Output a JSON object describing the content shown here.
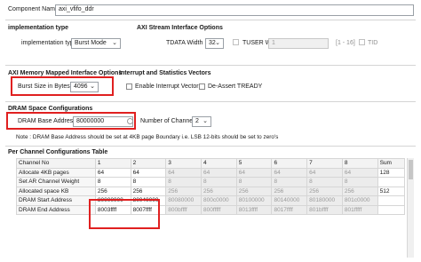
{
  "component": {
    "label": "Component Name",
    "value": "axi_vfifo_ddr"
  },
  "implementation": {
    "section": "implementation type",
    "label": "implementation type",
    "value": "Burst Mode"
  },
  "stream": {
    "section": "AXI Stream Interface Options",
    "tdata_label": "TDATA Width",
    "tdata_value": "32",
    "tuser_label": "TUSER Width",
    "tuser_value": "1",
    "range_hint": "[1 - 16]",
    "tid_label": "TID"
  },
  "mm": {
    "section": "AXI Memory Mapped Interface Options",
    "burst_label": "Burst Size in Bytes",
    "burst_value": "4096"
  },
  "interrupts": {
    "section": "Interrupt and Statistics Vectors",
    "enable_label": "Enable Interrupt Vectors",
    "deassert_label": "De-Assert TREADY"
  },
  "dram": {
    "section": "DRAM Space Configurations",
    "base_label": "DRAM Base Address",
    "base_value": "80000000",
    "channels_label": "Number of Channels",
    "channels_value": "2",
    "note": "Note : DRAM Base Address should be set at 4KB page Boundary i.e. LSB 12-bits should be set to zero's"
  },
  "per_channel": {
    "section": "Per Channel Configurations Table",
    "headers": [
      "Channel No",
      "1",
      "2",
      "3",
      "4",
      "5",
      "6",
      "7",
      "8",
      "Sum"
    ],
    "rows": [
      {
        "label": "Allocate 4KB pages",
        "cells": [
          "64",
          "64",
          "64",
          "64",
          "64",
          "64",
          "64",
          "64",
          "128"
        ]
      },
      {
        "label": "Set AR Channel Weight",
        "cells": [
          "8",
          "8",
          "8",
          "8",
          "8",
          "8",
          "8",
          "8",
          ""
        ]
      },
      {
        "label": "Allocated space KB",
        "cells": [
          "256",
          "256",
          "256",
          "256",
          "256",
          "256",
          "256",
          "256",
          "512"
        ]
      },
      {
        "label": "DRAM Start Address",
        "cells": [
          "80000000",
          "80040000",
          "80080000",
          "800c0000",
          "80100000",
          "80140000",
          "80180000",
          "801c0000",
          ""
        ]
      },
      {
        "label": "DRAM End Address",
        "cells": [
          "8003ffff",
          "8007ffff",
          "800bffff",
          "800fffff",
          "8013ffff",
          "8017ffff",
          "801bffff",
          "801fffff",
          ""
        ]
      }
    ],
    "enabled_columns": 2
  },
  "icons": {
    "dropdown": "chevron-down-icon",
    "info": "info-circle-icon"
  },
  "colors": {
    "highlight": "#e02020"
  }
}
